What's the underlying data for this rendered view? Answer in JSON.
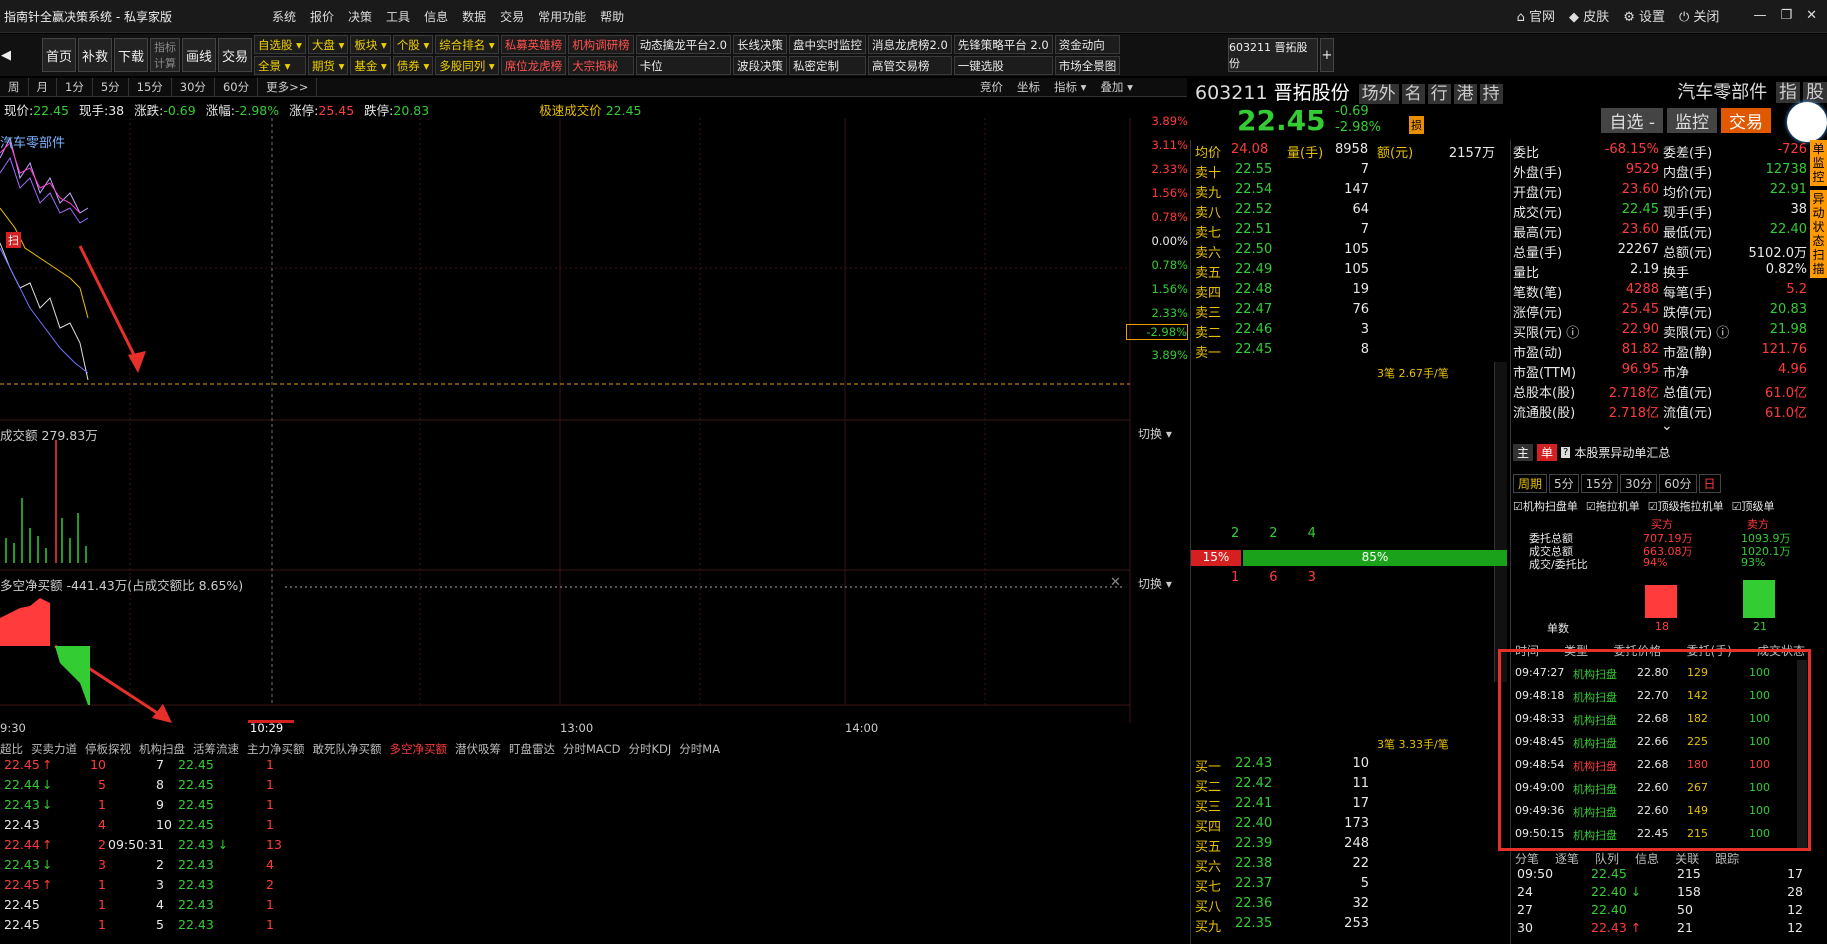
{
  "window": {
    "title": "指南针全赢决策系统 - 私享家版"
  },
  "menu": [
    "系统",
    "报价",
    "决策",
    "工具",
    "信息",
    "数据",
    "交易",
    "常用功能",
    "帮助"
  ],
  "window_buttons": [
    "官网",
    "皮肤",
    "设置",
    "关闭"
  ],
  "toolbar": {
    "main_buttons": [
      "首页",
      "补救",
      "下载",
      "指标\n计算",
      "画线",
      "交易"
    ],
    "grid": [
      {
        "top": "自选股 ▾",
        "bottom": "全景 ▾",
        "color": "y"
      },
      {
        "top": "大盘 ▾",
        "bottom": "期货 ▾",
        "color": "y"
      },
      {
        "top": "板块 ▾",
        "bottom": "基金 ▾",
        "color": "y"
      },
      {
        "top": "个股 ▾",
        "bottom": "债券 ▾",
        "color": "y"
      },
      {
        "top": "综合排名 ▾",
        "bottom": "多股同列 ▾",
        "color": "y"
      },
      {
        "top": "私募英雄榜",
        "bottom": "席位龙虎榜",
        "color": "r"
      },
      {
        "top": "机构调研榜",
        "bottom": "大宗揭秘",
        "color": "r"
      },
      {
        "top": "动态擒龙平台2.0",
        "bottom": "卡位",
        "color": "w"
      },
      {
        "top": "长线决策",
        "bottom": "波段决策",
        "color": "w"
      },
      {
        "top": "盘中实时监控",
        "bottom": "私密定制",
        "color": "w"
      },
      {
        "top": "消息龙虎榜2.0",
        "bottom": "高管交易榜",
        "color": "w"
      },
      {
        "top": "先锋策略平台 2.0",
        "bottom": "一键选股",
        "color": "w"
      },
      {
        "top": "资金动向",
        "bottom": "市场全景图",
        "color": "w"
      }
    ],
    "stock_tab": "603211 晋拓股份"
  },
  "periods": [
    "周",
    "月",
    "1分",
    "5分",
    "15分",
    "30分",
    "60分",
    "更多>>"
  ],
  "period_right": [
    "竞价",
    "坐标",
    "指标 ▾",
    "叠加 ▾"
  ],
  "info": {
    "price_label": "现价:",
    "price": "22.45",
    "vol_label": "现手:",
    "vol": "38",
    "chg_label": "涨跌:",
    "chg": "-0.69",
    "pct_label": "涨幅:",
    "pct": "-2.98%",
    "up_label": "涨停:",
    "up": "25.45",
    "down_label": "跌停:",
    "down": "20.83",
    "fast_label": "极速成交价",
    "fast": "22.45"
  },
  "chart": {
    "sector_label": "汽车零部件",
    "pct_ticks": [
      {
        "v": "3.89%",
        "c": "red"
      },
      {
        "v": "3.11%",
        "c": "red"
      },
      {
        "v": "2.33%",
        "c": "red"
      },
      {
        "v": "1.56%",
        "c": "red"
      },
      {
        "v": "0.78%",
        "c": "red"
      },
      {
        "v": "0.00%",
        "c": "white"
      },
      {
        "v": "0.78%",
        "c": "green"
      },
      {
        "v": "1.56%",
        "c": "green"
      },
      {
        "v": "2.33%",
        "c": "green"
      },
      {
        "v": "-2.98%",
        "c": "green"
      },
      {
        "v": "3.89%",
        "c": "green"
      }
    ],
    "volume_label": "成交额 279.83万",
    "switch": "切换 ▾",
    "net_label": "多空净买额 -441.43万(占成交额比 8.65%)",
    "time_ticks": [
      "9:30",
      "10:29",
      "13:00",
      "14:00"
    ],
    "indicator_tabs": [
      "超比",
      "买卖力道",
      "停板探视",
      "机构扫盘",
      "活筹流速",
      "主力净买额",
      "敢死队净买额",
      "多空净买额",
      "潜伏吸筹",
      "盯盘雷达",
      "分时MACD",
      "分时KDJ",
      "分时MA"
    ],
    "active_indicator": "多空净买额",
    "scan_tag": "扫"
  },
  "stock": {
    "code": "603211",
    "name": "晋拓股份",
    "tags": [
      "场外",
      "名",
      "行",
      "港",
      "持"
    ],
    "sector": "汽车零部件",
    "sector_tags": [
      "指",
      "股"
    ],
    "price": "22.45",
    "chg": "-0.69",
    "pct": "-2.98%",
    "badge": "损",
    "actions": [
      "自选 -",
      "监控",
      "交易"
    ]
  },
  "orderbook": {
    "avg_label": "均价",
    "avg": "24.08",
    "qty_label": "量(手)",
    "qty": "8958",
    "amt_label": "额(元)",
    "amt": "2157万",
    "asks": [
      {
        "l": "卖十",
        "p": "22.55",
        "q": "7"
      },
      {
        "l": "卖九",
        "p": "22.54",
        "q": "147"
      },
      {
        "l": "卖八",
        "p": "22.52",
        "q": "64"
      },
      {
        "l": "卖七",
        "p": "22.51",
        "q": "7"
      },
      {
        "l": "卖六",
        "p": "22.50",
        "q": "105"
      },
      {
        "l": "卖五",
        "p": "22.49",
        "q": "105"
      },
      {
        "l": "卖四",
        "p": "22.48",
        "q": "19"
      },
      {
        "l": "卖三",
        "p": "22.47",
        "q": "76"
      },
      {
        "l": "卖二",
        "p": "22.46",
        "q": "3"
      },
      {
        "l": "卖一",
        "p": "22.45",
        "q": "8"
      }
    ],
    "ask_note": "3笔 2.67手/笔",
    "bid_note": "3笔 3.33手/笔",
    "upper_nums": [
      "2",
      "2",
      "4"
    ],
    "lower_nums": [
      "1",
      "6",
      "3"
    ],
    "bar_left": "15%",
    "bar_right": "85%",
    "bids": [
      {
        "l": "买一",
        "p": "22.43",
        "q": "10"
      },
      {
        "l": "买二",
        "p": "22.42",
        "q": "11"
      },
      {
        "l": "买三",
        "p": "22.41",
        "q": "17"
      },
      {
        "l": "买四",
        "p": "22.40",
        "q": "173"
      },
      {
        "l": "买五",
        "p": "22.39",
        "q": "248"
      },
      {
        "l": "买六",
        "p": "22.38",
        "q": "22"
      },
      {
        "l": "买七",
        "p": "22.37",
        "q": "5"
      },
      {
        "l": "买八",
        "p": "22.36",
        "q": "32"
      },
      {
        "l": "买九",
        "p": "22.35",
        "q": "253"
      }
    ]
  },
  "stats": [
    {
      "l1": "委比",
      "v1": "-68.15%",
      "c1": "red",
      "l2": "委差(手)",
      "v2": "-726",
      "c2": "red"
    },
    {
      "l1": "外盘(手)",
      "v1": "9529",
      "c1": "red",
      "l2": "内盘(手)",
      "v2": "12738",
      "c2": "green"
    },
    {
      "l1": "开盘(元)",
      "v1": "23.60",
      "c1": "red",
      "l2": "均价(元)",
      "v2": "22.91",
      "c2": "green"
    },
    {
      "l1": "成交(元)",
      "v1": "22.45",
      "c1": "green",
      "l2": "现手(手)",
      "v2": "38",
      "c2": "white"
    },
    {
      "l1": "最高(元)",
      "v1": "23.60",
      "c1": "red",
      "l2": "最低(元)",
      "v2": "22.40",
      "c2": "green"
    },
    {
      "l1": "总量(手)",
      "v1": "22267",
      "c1": "white",
      "l2": "总额(元)",
      "v2": "5102.0万",
      "c2": "white"
    },
    {
      "l1": "量比",
      "v1": "2.19",
      "c1": "white",
      "l2": "换手",
      "v2": "0.82%",
      "c2": "white"
    },
    {
      "l1": "笔数(笔)",
      "v1": "4288",
      "c1": "red",
      "l2": "每笔(手)",
      "v2": "5.2",
      "c2": "red"
    },
    {
      "l1": "涨停(元)",
      "v1": "25.45",
      "c1": "red",
      "l2": "跌停(元)",
      "v2": "20.83",
      "c2": "green"
    },
    {
      "l1": "买限(元) ⓘ",
      "v1": "22.90",
      "c1": "red",
      "l2": "卖限(元) ⓘ",
      "v2": "21.98",
      "c2": "green"
    },
    {
      "l1": "市盈(动)",
      "v1": "81.82",
      "c1": "red",
      "l2": "市盈(静)",
      "v2": "121.76",
      "c2": "red"
    },
    {
      "l1": "市盈(TTM)",
      "v1": "96.95",
      "c1": "red",
      "l2": "市净",
      "v2": "4.96",
      "c2": "red"
    },
    {
      "l1": "总股本(股)",
      "v1": "2.718亿",
      "c1": "red",
      "l2": "总值(元)",
      "v2": "61.0亿",
      "c2": "red"
    },
    {
      "l1": "流通股(股)",
      "v1": "2.718亿",
      "c1": "red",
      "l2": "流值(元)",
      "v2": "61.0亿",
      "c2": "red"
    }
  ],
  "side_tabs": [
    "单监控",
    "异动状态扫描"
  ],
  "anomaly": {
    "tabs": [
      "主",
      "单"
    ],
    "title": "本股票异动单汇总",
    "periods": [
      "周期",
      "5分",
      "15分",
      "30分",
      "60分",
      "日"
    ],
    "checks": [
      "机构扫盘单",
      "拖拉机单",
      "顶级拖拉机单",
      "顶级单"
    ],
    "cols": [
      "买方",
      "卖方"
    ],
    "rows": [
      {
        "l": "委托总额",
        "b": "707.19万",
        "s": "1093.9万"
      },
      {
        "l": "成交总额",
        "b": "663.08万",
        "s": "1020.1万"
      },
      {
        "l": "成交/委托比",
        "b": "94%",
        "s": "93%"
      }
    ],
    "count_label": "单数",
    "buy_count": "18",
    "sell_count": "21",
    "buy_count_value": 18,
    "sell_count_value": 21,
    "table_headers": [
      "时间",
      "类型",
      "委托价格",
      "委托(手)",
      "成交状态"
    ],
    "table": [
      {
        "t": "09:47:27",
        "type": "机构扫盘",
        "p": "22.80",
        "q": "129",
        "s": "100",
        "c": "green"
      },
      {
        "t": "09:48:18",
        "type": "机构扫盘",
        "p": "22.70",
        "q": "142",
        "s": "100",
        "c": "green"
      },
      {
        "t": "09:48:33",
        "type": "机构扫盘",
        "p": "22.68",
        "q": "182",
        "s": "100",
        "c": "green"
      },
      {
        "t": "09:48:45",
        "type": "机构扫盘",
        "p": "22.66",
        "q": "225",
        "s": "100",
        "c": "green"
      },
      {
        "t": "09:48:54",
        "type": "机构扫盘",
        "p": "22.68",
        "q": "180",
        "s": "100",
        "c": "red"
      },
      {
        "t": "09:49:00",
        "type": "机构扫盘",
        "p": "22.60",
        "q": "267",
        "s": "100",
        "c": "green"
      },
      {
        "t": "09:49:36",
        "type": "机构扫盘",
        "p": "22.60",
        "q": "149",
        "s": "100",
        "c": "green"
      },
      {
        "t": "09:50:15",
        "type": "机构扫盘",
        "p": "22.45",
        "q": "215",
        "s": "100",
        "c": "green"
      }
    ],
    "bottom_tabs": [
      "分笔",
      "逐笔",
      "队列",
      "信息",
      "关联",
      "跟踪"
    ],
    "ticks": [
      {
        "t": "09:50",
        "p": "22.45",
        "q": "215",
        "n": "17"
      },
      {
        "t": "24",
        "p": "22.40 ↓",
        "q": "158",
        "n": "28"
      },
      {
        "t": "27",
        "p": "22.40",
        "q": "50",
        "n": "12"
      },
      {
        "t": "30",
        "p": "22.43 ↑",
        "q": "21",
        "n": "12"
      }
    ]
  },
  "trades": [
    [
      {
        "p": "22.45",
        "a": "↑",
        "q": "10"
      },
      {
        "p": "22.44",
        "a": "↓",
        "q": "5"
      },
      {
        "p": "22.43",
        "a": "↓",
        "q": "1"
      },
      {
        "p": "22.43",
        "a": "",
        "q": "4"
      },
      {
        "p": "22.44",
        "a": "↑",
        "q": "2"
      },
      {
        "p": "22.43",
        "a": "↓",
        "q": "3"
      },
      {
        "p": "22.45",
        "a": "↑",
        "q": "1"
      },
      {
        "p": "22.45",
        "a": "",
        "q": "1"
      },
      {
        "p": "22.45",
        "a": "",
        "q": "1"
      }
    ],
    [
      {
        "n": "7",
        "p": "22.45",
        "q": "1"
      },
      {
        "n": "8",
        "p": "22.45",
        "q": "1"
      },
      {
        "n": "9",
        "p": "22.45",
        "q": "1"
      },
      {
        "n": "10",
        "p": "22.45",
        "q": "1"
      },
      {
        "n": "09:50:31",
        "p": "22.43 ↓",
        "q": "13"
      },
      {
        "n": "2",
        "p": "22.43",
        "q": "4"
      },
      {
        "n": "3",
        "p": "22.43",
        "q": "2"
      },
      {
        "n": "4",
        "p": "22.43",
        "q": "1"
      },
      {
        "n": "5",
        "p": "22.43",
        "q": "1"
      }
    ]
  ]
}
